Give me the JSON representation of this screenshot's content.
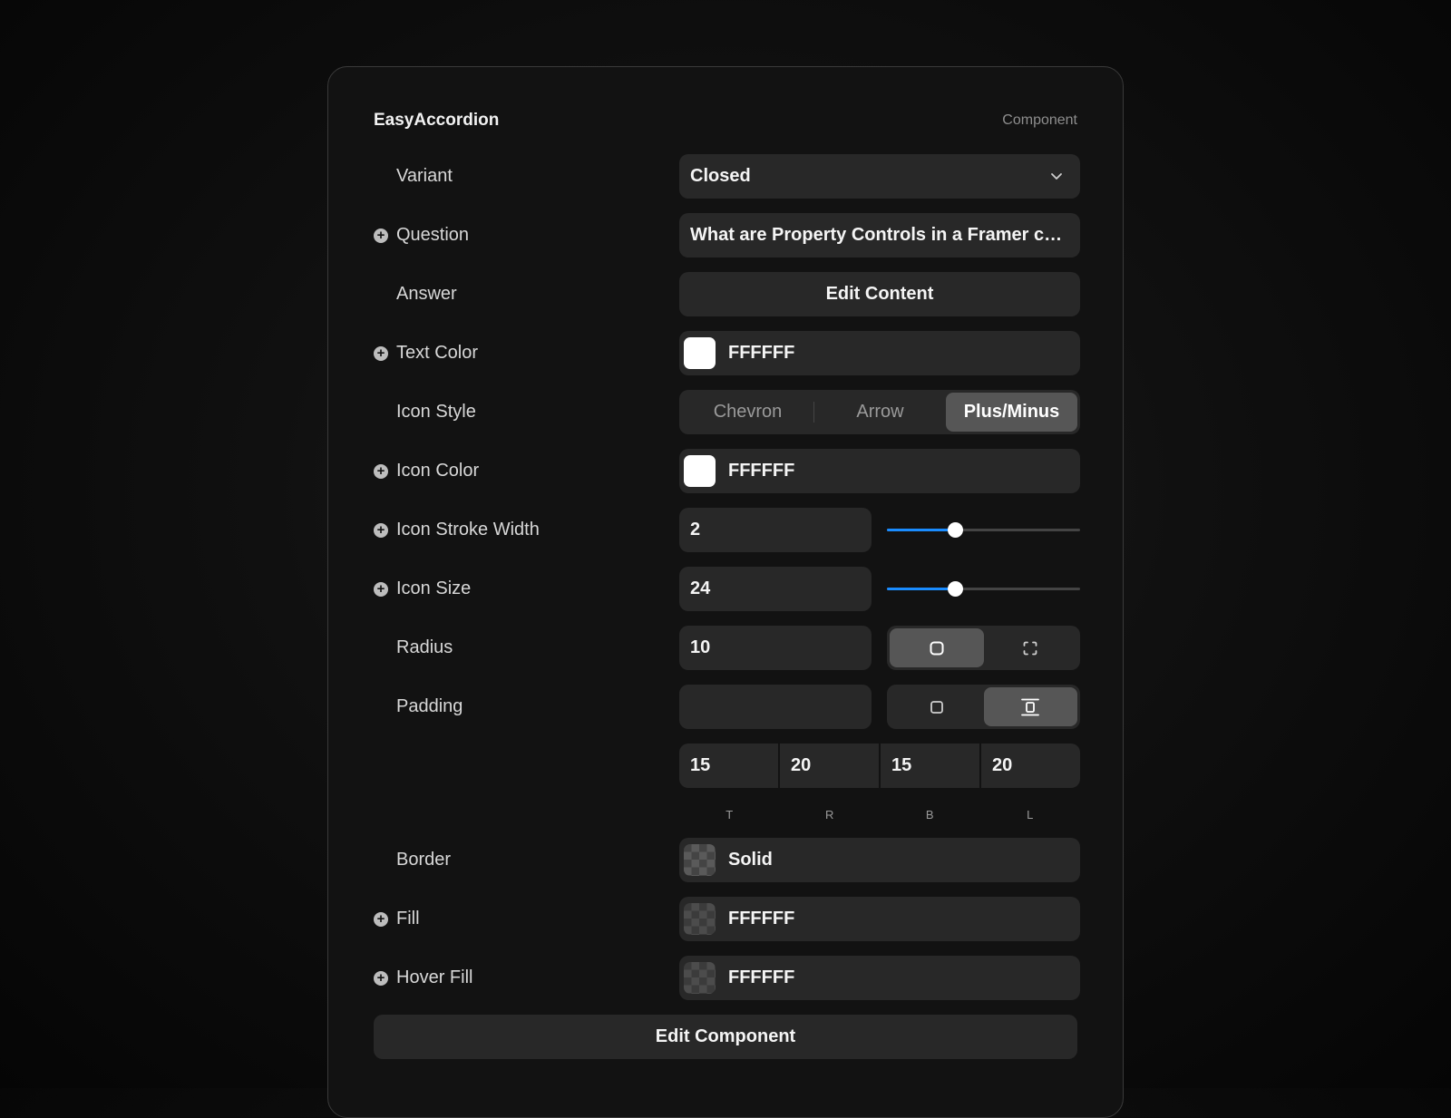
{
  "panel": {
    "title": "EasyAccordion",
    "subtitle": "Component"
  },
  "variant": {
    "label": "Variant",
    "value": "Closed",
    "icon": "chevron-down-icon"
  },
  "question": {
    "label": "Question",
    "value": "What are Property Controls in a Framer co..."
  },
  "answer": {
    "label": "Answer",
    "button": "Edit Content"
  },
  "text_color": {
    "label": "Text Color",
    "value": "FFFFFF",
    "swatch": "#FFFFFF"
  },
  "icon_style": {
    "label": "Icon Style",
    "options": [
      "Chevron",
      "Arrow",
      "Plus/Minus"
    ],
    "selected": "Plus/Minus"
  },
  "icon_color": {
    "label": "Icon Color",
    "value": "FFFFFF",
    "swatch": "#FFFFFF"
  },
  "icon_stroke_width": {
    "label": "Icon Stroke Width",
    "value": "2",
    "slider_fraction": 0.35,
    "accent": "#1A8CFF"
  },
  "icon_size": {
    "label": "Icon Size",
    "value": "24",
    "slider_fraction": 0.35,
    "accent": "#1A8CFF"
  },
  "radius": {
    "label": "Radius",
    "value": "10",
    "mode_options": [
      "uniform-corners-icon",
      "individual-corners-icon"
    ],
    "selected_mode": "uniform-corners-icon"
  },
  "padding": {
    "label": "Padding",
    "value": "",
    "mode_options": [
      "uniform-padding-icon",
      "individual-padding-icon"
    ],
    "selected_mode": "individual-padding-icon",
    "sides": [
      {
        "label": "T",
        "value": "15"
      },
      {
        "label": "R",
        "value": "20"
      },
      {
        "label": "B",
        "value": "15"
      },
      {
        "label": "L",
        "value": "20"
      }
    ]
  },
  "border": {
    "label": "Border",
    "value": "Solid"
  },
  "fill": {
    "label": "Fill",
    "value": "FFFFFF"
  },
  "hover_fill": {
    "label": "Hover Fill",
    "value": "FFFFFF"
  },
  "edit_component": {
    "button": "Edit Component"
  }
}
